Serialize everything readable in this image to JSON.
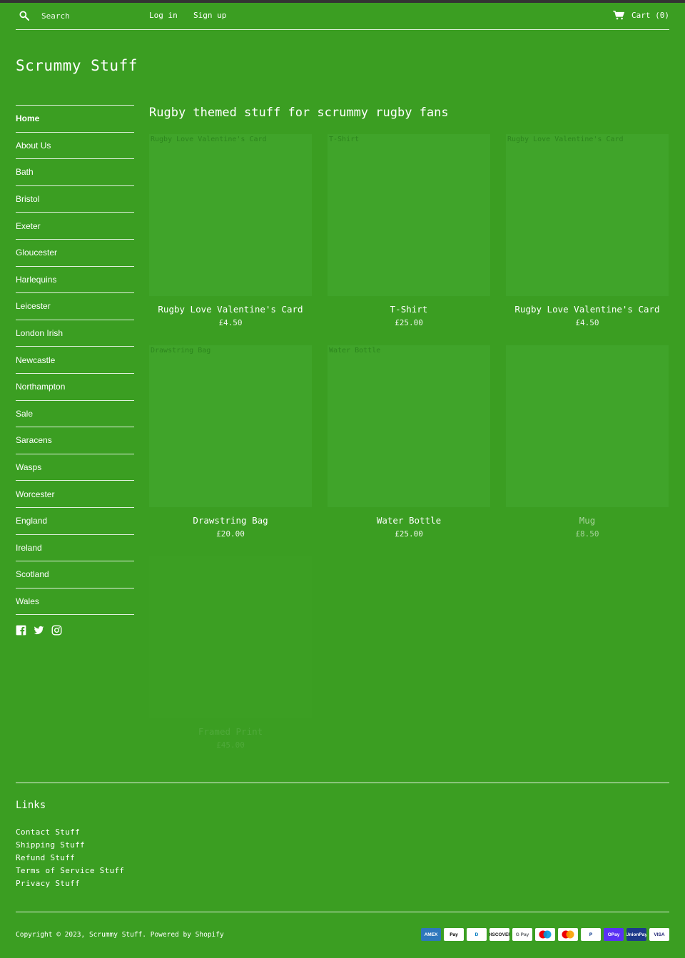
{
  "header": {
    "search_placeholder": "Search",
    "login": "Log in",
    "signup": "Sign up",
    "cart": "Cart (0)"
  },
  "site_title": "Scrummy Stuff",
  "sidebar": {
    "items": [
      {
        "label": "Home",
        "active": true
      },
      {
        "label": "About Us"
      },
      {
        "label": "Bath"
      },
      {
        "label": "Bristol"
      },
      {
        "label": "Exeter"
      },
      {
        "label": "Gloucester"
      },
      {
        "label": "Harlequins"
      },
      {
        "label": "Leicester"
      },
      {
        "label": "London Irish"
      },
      {
        "label": "Newcastle"
      },
      {
        "label": "Northampton"
      },
      {
        "label": "Sale"
      },
      {
        "label": "Saracens"
      },
      {
        "label": "Wasps"
      },
      {
        "label": "Worcester"
      },
      {
        "label": "England"
      },
      {
        "label": "Ireland"
      },
      {
        "label": "Scotland"
      },
      {
        "label": "Wales"
      }
    ],
    "social_icons": [
      "facebook-icon",
      "twitter-icon",
      "instagram-icon"
    ]
  },
  "main": {
    "title": "Rugby themed stuff for scrummy rugby fans",
    "products": [
      {
        "name": "Rugby Love Valentine's Card",
        "price": "£4.50",
        "image_alt": "Rugby Love Valentine's Card"
      },
      {
        "name": "T-Shirt",
        "price": "£25.00",
        "image_alt": "T-Shirt"
      },
      {
        "name": "Rugby Love Valentine's Card",
        "price": "£4.50",
        "image_alt": "Rugby Love Valentine's Card"
      },
      {
        "name": "Drawstring Bag",
        "price": "£20.00",
        "image_alt": "Drawstring Bag"
      },
      {
        "name": "Water Bottle",
        "price": "£25.00",
        "image_alt": "Water Bottle"
      },
      {
        "name": "Mug",
        "price": "£8.50",
        "image_alt": ""
      },
      {
        "name": "Framed Print",
        "price": "£45.00",
        "image_alt": ""
      }
    ]
  },
  "footer": {
    "links_title": "Links",
    "links": [
      "Contact Stuff",
      "Shipping Stuff",
      "Refund Stuff",
      "Terms of Service Stuff",
      "Privacy Stuff"
    ],
    "copyright": "Copyright © 2023, Scrummy Stuff. Powered by Shopify",
    "payments": [
      {
        "label": "AMEX",
        "bg": "#2e77bc",
        "fg": "#ffffff"
      },
      {
        "label": "Pay",
        "bg": "#ffffff",
        "fg": "#000000"
      },
      {
        "label": "D",
        "bg": "#ffffff",
        "fg": "#0079be"
      },
      {
        "label": "DISCOVER",
        "bg": "#ffffff",
        "fg": "#222222"
      },
      {
        "label": "G Pay",
        "bg": "#ffffff",
        "fg": "#5f6368"
      },
      {
        "label": "",
        "bg": "#ffffff",
        "fg": "#000000"
      },
      {
        "label": "",
        "bg": "#ffffff",
        "fg": "#000000"
      },
      {
        "label": "P",
        "bg": "#ffffff",
        "fg": "#003087"
      },
      {
        "label": "OPay",
        "bg": "#5a31f4",
        "fg": "#ffffff"
      },
      {
        "label": "UnionPay",
        "bg": "#1e3a8a",
        "fg": "#ffffff"
      },
      {
        "label": "VISA",
        "bg": "#ffffff",
        "fg": "#1a1f71"
      }
    ]
  }
}
